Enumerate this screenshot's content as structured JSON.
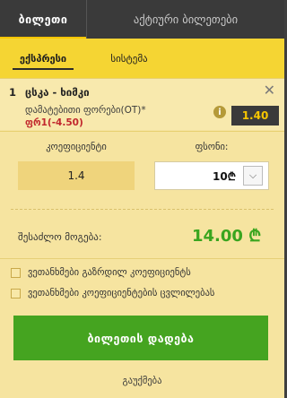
{
  "tabs": {
    "ticket": "ბილეთი",
    "active_tickets": "აქტიური ბილეთები"
  },
  "subtabs": {
    "express": "ექსპრესი",
    "system": "სისტემა"
  },
  "event": {
    "index": "1",
    "title": "ცსკა - ხიმკი",
    "market": "დამატებითი ფორები(OT)*",
    "outcome": "ფრ1(-4.50)",
    "odd": "1.40"
  },
  "inputs": {
    "coef_label": "კოეფიციენტი",
    "coef_value": "1.4",
    "amount_label": "ფსონი:",
    "amount_value": "10₾"
  },
  "payout": {
    "label": "შესაძლო მოგება:",
    "value": "14.00 ₾"
  },
  "options": [
    "ვეთანხმები გაზრდილ კოეფიციენტს",
    "ვეთანხმები კოეფიციენტების ცვლილებას"
  ],
  "actions": {
    "place_bet": "ბილეთის დადება",
    "cancel": "გაუქმება"
  },
  "colors": {
    "accent": "#f7c600",
    "primary_button": "#45a420",
    "outcome_red": "#c1272d"
  }
}
